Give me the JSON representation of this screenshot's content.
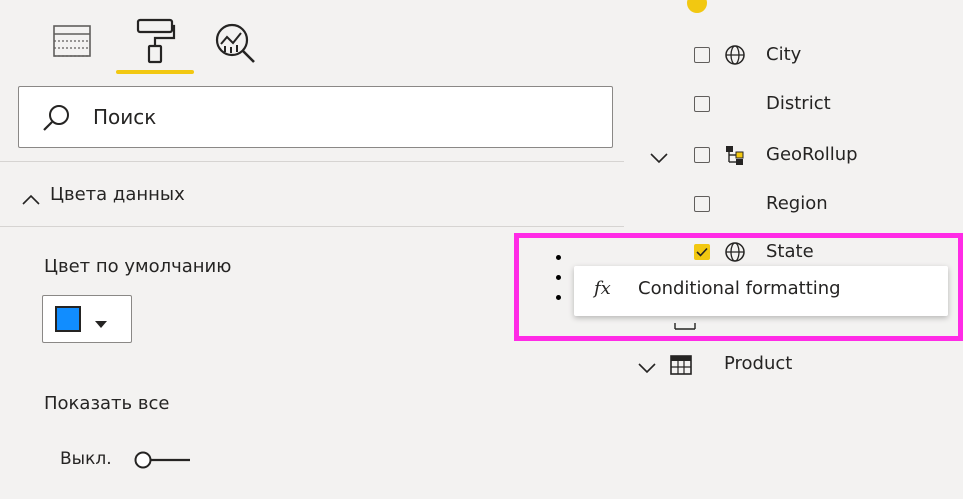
{
  "format_pane": {
    "tool_icons": [
      "fields-icon",
      "paint-roller-icon",
      "analytics-icon"
    ],
    "active_tool": "paint-roller-icon",
    "search": {
      "placeholder": "Поиск",
      "value": ""
    },
    "section_title": "Цвета данных",
    "default_color_label": "Цвет по умолчанию",
    "default_color_value": "#118dff",
    "show_all_label": "Показать все",
    "toggle_label": "Выкл.",
    "toggle_state": "off"
  },
  "fields_pane": {
    "items": [
      {
        "label": "City",
        "checked": false,
        "icon": "globe-icon"
      },
      {
        "label": "District",
        "checked": false,
        "icon": ""
      },
      {
        "label": "GeoRollup",
        "checked": false,
        "icon": "hierarchy-icon",
        "expandable": true
      },
      {
        "label": "Region",
        "checked": false,
        "icon": ""
      },
      {
        "label": "State",
        "checked": true,
        "icon": "globe-icon"
      }
    ],
    "table": {
      "label": "Product",
      "icon": "table-icon"
    }
  },
  "context_menu": {
    "item_label": "Conditional formatting",
    "item_icon": "fx-icon"
  },
  "colors": {
    "accent_yellow": "#f2c811",
    "highlight_magenta": "#ff2be6",
    "swatch_blue": "#118dff"
  }
}
